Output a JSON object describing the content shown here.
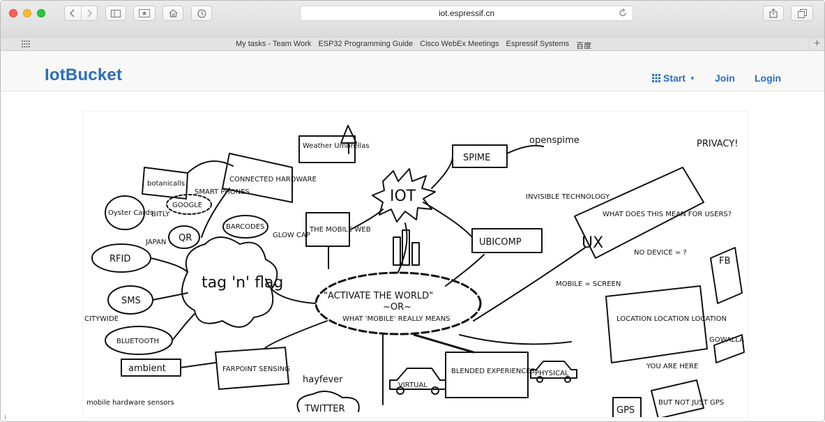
{
  "browser": {
    "url": "iot.espressif.cn",
    "bookmarks": [
      "My tasks - Team Work",
      "ESP32 Programming Guide",
      "Cisco WebEx Meetings",
      "Espressif Systems",
      "百度"
    ]
  },
  "navbar": {
    "brand": "IotBucket",
    "start_label": "Start",
    "join_label": "Join",
    "login_label": "Login"
  },
  "hero": {
    "labels": {
      "center": "\"ACTIVATE THE WORLD\"",
      "center_or": "~OR~",
      "center_sub": "WHAT 'MOBILE' REALLY MEANS",
      "iot": "IOT",
      "spime": "SPIME",
      "openspime": "openspime",
      "weather": "Weather Umbrellas",
      "connected": "CONNECTED HARDWARE",
      "botanicalls": "botanicalls",
      "google": "GOOGLE",
      "bitly": "BITLY",
      "smart_phones": "SMART PHONES",
      "barcodes": "BARCODES",
      "qr": "QR",
      "oyster": "Oyster Cards",
      "japan": "JAPAN",
      "rfid": "RFID",
      "sms": "SMS",
      "tag": "tag 'n' flag",
      "bluetooth": "BLUETOOTH",
      "citywide": "CITYWIDE",
      "ambient": "ambient",
      "farpoint": "FARPOINT SENSING",
      "glow_cap": "GLOW CAP",
      "mobile_web": "THE MOBILE WEB",
      "ubicomp": "UBICOMP",
      "invisible": "INVISIBLE TECHNOLOGY",
      "ux": "UX",
      "ux_question": "WHAT DOES THIS MEAN FOR USERS?",
      "privacy": "PRIVACY!",
      "location": "LOCATION LOCATION LOCATION",
      "blended": "BLENDED EXPERIENCES",
      "virtual": "VIRTUAL",
      "physical": "PHYSICAL",
      "twitter": "TWITTER",
      "hayfever": "hayfever",
      "gps": "GPS",
      "but_not": "BUT NOT JUST GPS",
      "mobile_screen": "MOBILE = SCREEN",
      "no_device": "NO DEVICE = ?",
      "mobile_sensors": "mobile hardware sensors",
      "fb": "FB",
      "gowalla": "GOWALLA",
      "you_are_here": "YOU ARE HERE"
    }
  }
}
